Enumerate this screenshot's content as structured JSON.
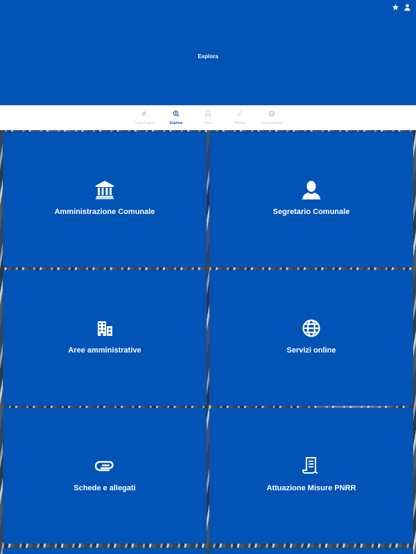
{
  "header": {
    "title": "Esplora",
    "actions": [
      {
        "icon": "star-icon"
      },
      {
        "icon": "user-icon"
      }
    ]
  },
  "tabs": [
    {
      "label": "Prima Pagina",
      "icon": "home-icon",
      "active": false
    },
    {
      "label": "Esplora",
      "icon": "explore-icon",
      "active": true
    },
    {
      "label": "Menu",
      "icon": "grid-icon",
      "active": false
    },
    {
      "label": "Risorse",
      "icon": "link-icon",
      "active": false
    },
    {
      "label": "Impostazioni",
      "icon": "gear-icon",
      "active": false
    }
  ],
  "tiles": [
    {
      "label": "Amministrazione Comunale",
      "icon": "bank-icon"
    },
    {
      "label": "Segretario Comunale",
      "icon": "person-icon"
    },
    {
      "label": "Aree amministrative",
      "icon": "buildings-icon"
    },
    {
      "label": "Servizi online",
      "icon": "globe-icon"
    },
    {
      "label": "Schede e allegati",
      "icon": "paperclip-icon"
    },
    {
      "label": "Attuazione Misure PNRR",
      "icon": "receipt-icon"
    }
  ],
  "colors": {
    "primary": "#0153B6",
    "tab_inactive": "#c9c9c9",
    "surface": "#ffffff"
  }
}
